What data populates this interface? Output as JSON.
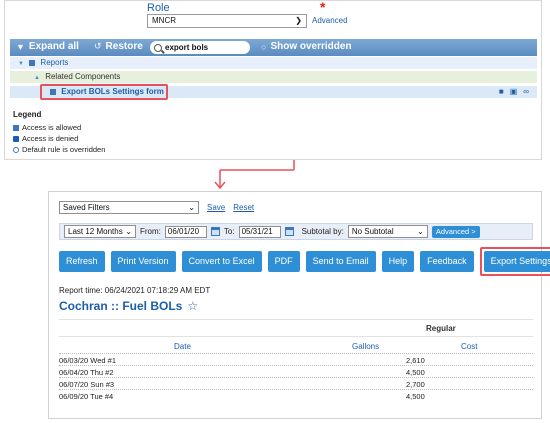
{
  "role": {
    "label": "Role",
    "required_marker": "*",
    "selected": "MNCR",
    "advanced_link": "Advanced"
  },
  "toolbar": {
    "expand_all": "Expand all",
    "restore": "Restore",
    "search_value": "export bols",
    "show_overridden": "Show overridden"
  },
  "tree": {
    "reports": "Reports",
    "related_components": "Related Components",
    "export_settings_form": "Export BOLs Settings form"
  },
  "legend": {
    "title": "Legend",
    "items": [
      "Access is allowed",
      "Access is denied",
      "Default rule is overridden"
    ]
  },
  "report": {
    "saved_filters": "Saved Filters",
    "save_link": "Save",
    "reset_link": "Reset",
    "period": "Last 12 Months",
    "from_label": "From:",
    "from_value": "06/01/20",
    "to_label": "To:",
    "to_value": "05/31/21",
    "subtotal_label": "Subtotal by:",
    "subtotal_value": "No Subtotal",
    "advanced_button": "Advanced >",
    "buttons": [
      "Refresh",
      "Print Version",
      "Convert to Excel",
      "PDF",
      "Send to Email",
      "Help",
      "Feedback"
    ],
    "export_settings_button": "Export Settings",
    "report_time": "Report time: 06/24/2021 07:18:29 AM EDT",
    "title": "Cochran :: Fuel BOLs",
    "star": "☆",
    "group_header": "Regular",
    "columns": {
      "date": "Date",
      "gallons": "Gallons",
      "cost": "Cost"
    },
    "rows": [
      {
        "date": "06/03/20 Wed #1",
        "gallons": "2,610"
      },
      {
        "date": "06/04/20 Thu #2",
        "gallons": "4,500"
      },
      {
        "date": "06/07/20 Sun #3",
        "gallons": "2,700"
      },
      {
        "date": "06/09/20 Tue #4",
        "gallons": "4,500"
      }
    ]
  },
  "colors": {
    "accent_blue": "#2f8fd6",
    "link_blue": "#1d5ea8",
    "highlight_red": "#e8505b",
    "toolbar_blue": "#5a8bc0"
  }
}
